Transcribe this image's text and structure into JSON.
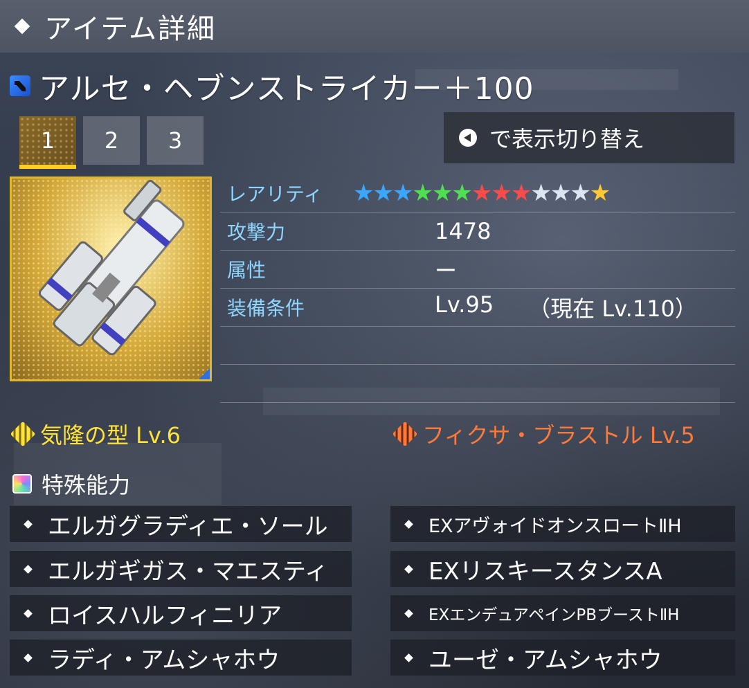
{
  "header": {
    "title": "アイテム詳細"
  },
  "item": {
    "name": "アルセ・ヘブンストライカー＋100",
    "type_icon": "launcher-weapon-icon"
  },
  "tabs": [
    {
      "label": "1",
      "active": true
    },
    {
      "label": "2",
      "active": false
    },
    {
      "label": "3",
      "active": false
    }
  ],
  "toggle_hint": {
    "icon": "left-button-icon",
    "text": "で表示切り替え"
  },
  "stats": {
    "rarity": {
      "label": "レアリティ",
      "value": 13,
      "star_colors": [
        "#3aa6ff",
        "#3aa6ff",
        "#3aa6ff",
        "#4fe04f",
        "#4fe04f",
        "#4fe04f",
        "#ff4a4a",
        "#ff4a4a",
        "#ff4a4a",
        "#dde6f0",
        "#dde6f0",
        "#dde6f0",
        "#ffc830"
      ]
    },
    "attack": {
      "label": "攻撃力",
      "value": "1478"
    },
    "element": {
      "label": "属性",
      "value": "ー"
    },
    "requirement": {
      "label": "装備条件",
      "value": "Lv.95",
      "current": "（現在  Lv.110）"
    }
  },
  "potentials": {
    "left": {
      "text": "気隆の型  Lv.6",
      "color": "#ffe23a",
      "icon": "potential-icon"
    },
    "right": {
      "text": "フィクサ・ブラストル  Lv.5",
      "color": "#ff7a3a",
      "icon": "latent-ability-icon"
    }
  },
  "special": {
    "label": "特殊能力",
    "icon": "special-ability-icon"
  },
  "abilities": {
    "left": [
      "エルガグラディエ・ソール",
      "エルガギガス・マエスティ",
      "ロイスハルフィニリア",
      "ラディ・アムシャホウ"
    ],
    "right": [
      "EXアヴォイドオンスロートⅡH",
      "EXリスキースタンスA",
      "EXエンデュアペインPBブーストⅡH",
      "ユーゼ・アムシャホウ"
    ]
  }
}
